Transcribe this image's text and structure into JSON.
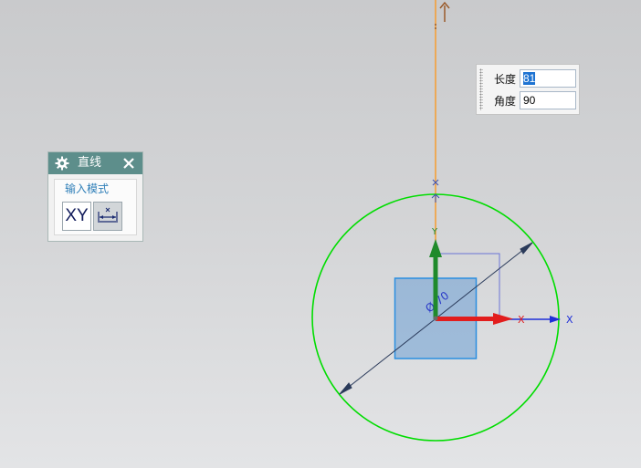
{
  "dialog": {
    "title": "直线",
    "title_icon": "gear-icon",
    "close_icon": "close-icon",
    "group_label": "输入模式",
    "modes": [
      {
        "label": "XY",
        "icon": "xy-mode-icon",
        "selected": false
      },
      {
        "label": "",
        "icon": "parameter-mode-icon",
        "selected": true
      }
    ]
  },
  "dynamic_input": {
    "length_label": "长度",
    "length_value": "81",
    "angle_label": "角度",
    "angle_value": "90"
  },
  "sketch": {
    "diameter_label": "Ø 70",
    "axis_x_label": "X",
    "axis_y_label": "Y"
  },
  "colors": {
    "title_bar": "#5d8e8b",
    "group_label": "#2f7fb8",
    "circle": "#00dd00",
    "line_preview": "#f4a03a",
    "x_axis": "#e21d1d",
    "y_axis": "#1f8a2b",
    "wcs_axis": "#1f2fd8",
    "selection": "#1e73d2"
  }
}
